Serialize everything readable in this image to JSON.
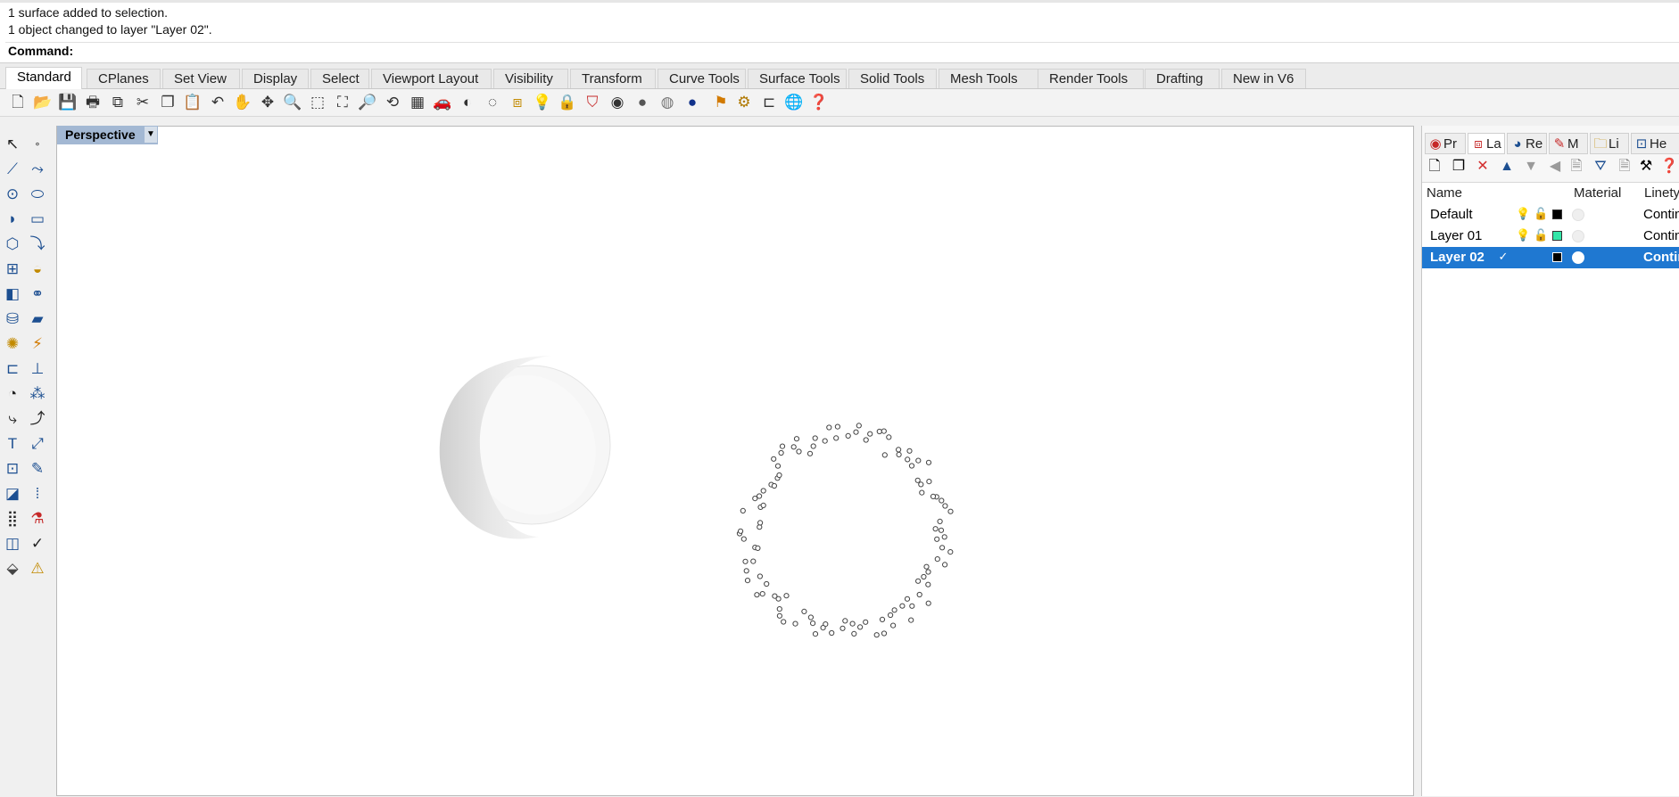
{
  "history": {
    "line1": "1 surface added to selection.",
    "line2": "1 object changed to layer \"Layer 02\".",
    "prompt": "Command:",
    "input_value": ""
  },
  "tabs": [
    {
      "label": "Standard",
      "active": true
    },
    {
      "label": "CPlanes"
    },
    {
      "label": "Set View"
    },
    {
      "label": "Display"
    },
    {
      "label": "Select"
    },
    {
      "label": "Viewport Layout"
    },
    {
      "label": "Visibility"
    },
    {
      "label": "Transform"
    },
    {
      "label": "Curve Tools"
    },
    {
      "label": "Surface Tools"
    },
    {
      "label": "Solid Tools"
    },
    {
      "label": "Mesh Tools"
    },
    {
      "label": "Render Tools"
    },
    {
      "label": "Drafting"
    },
    {
      "label": "New in V6"
    }
  ],
  "toolbar_icons": [
    "new-file-icon",
    "open-folder-icon",
    "save-icon",
    "print-icon",
    "import-icon",
    "cut-icon",
    "copy-icon",
    "paste-icon",
    "undo-icon",
    "pan-hand-icon",
    "rotate-view-icon",
    "zoom-icon",
    "zoom-window-icon",
    "zoom-extents-icon",
    "zoom-selected-icon",
    "rotate-camera-icon",
    "four-viewports-icon",
    "car-render-icon",
    "hide-icon",
    "show-icon",
    "layers-icon",
    "lightbulb-icon",
    "lock-icon",
    "material-icon",
    "color-wheel-icon",
    "shaded-sphere-icon",
    "ghosted-sphere-icon",
    "rendered-sphere-icon",
    "options-flag-icon",
    "settings-gear-icon",
    "dimension-icon",
    "globe-icon",
    "help-icon"
  ],
  "viewport": {
    "label": "Perspective"
  },
  "panel": {
    "tabs": [
      {
        "label": "Pr",
        "icon": "properties-icon"
      },
      {
        "label": "La",
        "icon": "layers-tab-icon",
        "active": true
      },
      {
        "label": "Re",
        "icon": "render-tab-icon"
      },
      {
        "label": "M",
        "icon": "materials-tab-icon"
      },
      {
        "label": "Li",
        "icon": "libraries-tab-icon"
      },
      {
        "label": "He",
        "icon": "help-tab-icon"
      }
    ],
    "columns": {
      "name": "Name",
      "material": "Material",
      "linetype": "Linety"
    },
    "layers": [
      {
        "name": "Default",
        "color": "#000000",
        "linetype": "Contin"
      },
      {
        "name": "Layer 01",
        "color": "#33e6a8",
        "linetype": "Contin"
      },
      {
        "name": "Layer 02",
        "color": "#000000",
        "linetype": "Contin",
        "selected": true,
        "current": true
      }
    ]
  },
  "colors": {
    "selection": "#1f78d1",
    "viewport_tab": "#a3b8d3"
  }
}
